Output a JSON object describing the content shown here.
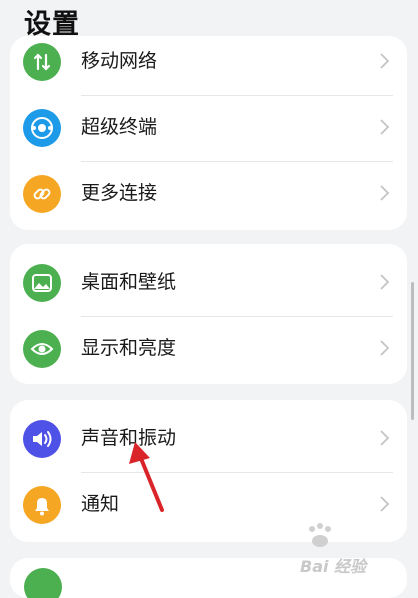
{
  "title": "设置",
  "groups": [
    {
      "items": [
        {
          "label": "移动网络",
          "icon": "mobile-network-icon",
          "color": "#4caf50"
        },
        {
          "label": "超级终端",
          "icon": "super-device-icon",
          "color": "#1e9be8"
        },
        {
          "label": "更多连接",
          "icon": "more-connections-icon",
          "color": "#f5a623"
        }
      ]
    },
    {
      "items": [
        {
          "label": "桌面和壁纸",
          "icon": "wallpaper-icon",
          "color": "#4caf50"
        },
        {
          "label": "显示和亮度",
          "icon": "display-icon",
          "color": "#4caf50"
        }
      ]
    },
    {
      "items": [
        {
          "label": "声音和振动",
          "icon": "sound-icon",
          "color": "#4f52e6"
        },
        {
          "label": "通知",
          "icon": "notification-bell-icon",
          "color": "#f5a623"
        }
      ]
    }
  ],
  "watermark": {
    "text": "Bai 经验"
  }
}
